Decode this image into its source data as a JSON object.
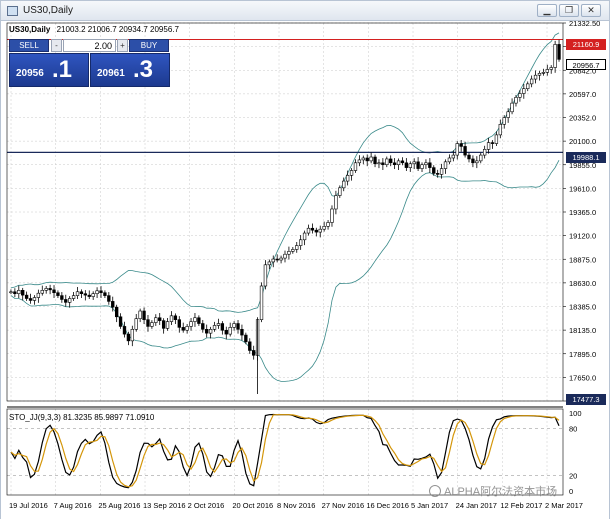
{
  "window": {
    "title": "US30,Daily"
  },
  "symbol_info": {
    "symbol": "US30,Daily",
    "ohlc": "21003.2 21006.7 20934.7 20956.7"
  },
  "trade_panel": {
    "sell_label": "SELL",
    "buy_label": "BUY",
    "minus_label": "-",
    "plus_label": "+",
    "lot": "2.00",
    "sell_price_small": "20956",
    "sell_price_big": ".1",
    "buy_price_small": "20961",
    "buy_price_big": ".3"
  },
  "price_tags": {
    "red": "21160.9",
    "current": "20956.7",
    "black_line": "19988.1",
    "low": "17477.3"
  },
  "oscillator_label": "STO_JJ(9,3,3) 81.3235 85.9897 71.0910",
  "watermark": "ALPHA阿尔法资本市场",
  "colors": {
    "accent": "#2c4fa8",
    "red_line": "#d42020",
    "candle": "#000000",
    "grid": "#c8c8c8",
    "band": "#3a8a8a",
    "main_line": "#000000",
    "signal_line": "#d4960a"
  },
  "chart_data": {
    "type": "candlestick",
    "y_ticks": [
      "21332.50",
      "21087.0",
      "20842.0",
      "20597.0",
      "20352.0",
      "20100.0",
      "19855.0",
      "19610.0",
      "19365.0",
      "19120.0",
      "18875.0",
      "18630.0",
      "18385.0",
      "18135.0",
      "17895.0",
      "17650.0",
      "17405.0"
    ],
    "x_ticks": [
      "19 Jul 2016",
      "7 Aug 2016",
      "25 Aug 2016",
      "13 Sep 2016",
      "2 Oct 2016",
      "20 Oct 2016",
      "8 Nov 2016",
      "27 Nov 2016",
      "16 Dec 2016",
      "5 Jan 2017",
      "24 Jan 2017",
      "12 Feb 2017",
      "2 Mar 2017"
    ],
    "osc_ticks": [
      "100",
      "80",
      "20",
      "0"
    ],
    "ylim": [
      17405,
      21332.5
    ],
    "horizontal_lines": [
      21160.9,
      19988.1
    ],
    "closes": [
      18540,
      18520,
      18555,
      18505,
      18470,
      18450,
      18480,
      18525,
      18555,
      18575,
      18560,
      18530,
      18500,
      18460,
      18430,
      18470,
      18500,
      18540,
      18520,
      18505,
      18490,
      18520,
      18550,
      18530,
      18500,
      18440,
      18380,
      18280,
      18180,
      18100,
      18030,
      18150,
      18260,
      18340,
      18250,
      18180,
      18220,
      18270,
      18240,
      18160,
      18230,
      18290,
      18250,
      18170,
      18140,
      18180,
      18230,
      18270,
      18210,
      18150,
      18110,
      18150,
      18190,
      18210,
      18140,
      18100,
      18170,
      18210,
      18150,
      18090,
      18020,
      17930,
      17880,
      18250,
      18600,
      18820,
      18850,
      18880,
      18870,
      18890,
      18930,
      18960,
      18980,
      19020,
      19080,
      19150,
      19200,
      19180,
      19160,
      19190,
      19220,
      19260,
      19400,
      19540,
      19620,
      19690,
      19750,
      19800,
      19880,
      19910,
      19930,
      19900,
      19940,
      19870,
      19880,
      19860,
      19920,
      19880,
      19860,
      19900,
      19880,
      19830,
      19870,
      19890,
      19820,
      19860,
      19880,
      19830,
      19770,
      19760,
      19820,
      19890,
      19930,
      19960,
      20080,
      20050,
      19960,
      19920,
      19880,
      19900,
      19960,
      20020,
      20090,
      20080,
      20170,
      20280,
      20350,
      20410,
      20500,
      20560,
      20600,
      20650,
      20700,
      20750,
      20790,
      20810,
      20820,
      20850,
      20870,
      21110,
      20955
    ]
  }
}
